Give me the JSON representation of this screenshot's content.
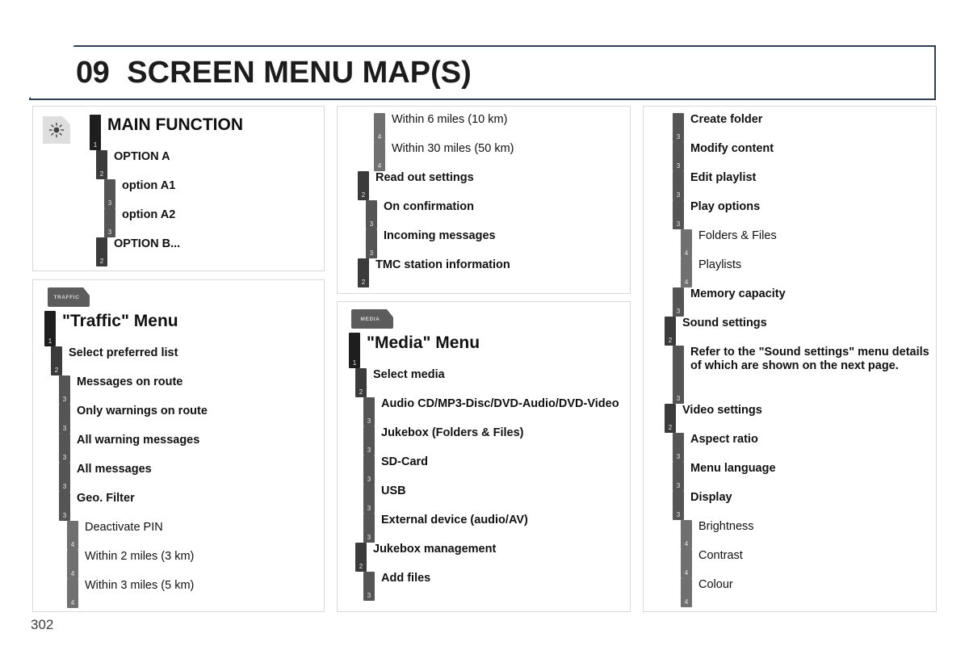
{
  "header": {
    "chapter_number": "09",
    "title": "SCREEN MENU MAP(S)",
    "border_color": "#2e4057"
  },
  "page_number": "302",
  "level_colors": {
    "level1": "#1e1e1e",
    "level2": "#3b3b3b",
    "level3": "#555555",
    "level4": "#707070"
  },
  "panels": [
    {
      "id": "main-function",
      "badge": {
        "type": "sun-icon",
        "label": ""
      },
      "items": [
        {
          "level": 1,
          "label": "MAIN FUNCTION"
        },
        {
          "level": 2,
          "label": "OPTION A"
        },
        {
          "level": 3,
          "label": "option A1"
        },
        {
          "level": 3,
          "label": "option A2"
        },
        {
          "level": 2,
          "label": "OPTION B..."
        }
      ]
    },
    {
      "id": "traffic-menu",
      "badge": {
        "type": "traffic-badge",
        "label": "TRAFFIC"
      },
      "items": [
        {
          "level": 1,
          "label": "\"Traffic\" Menu"
        },
        {
          "level": 2,
          "label": "Select preferred list"
        },
        {
          "level": 3,
          "label": "Messages on route"
        },
        {
          "level": 3,
          "label": "Only warnings on route"
        },
        {
          "level": 3,
          "label": "All warning messages"
        },
        {
          "level": 3,
          "label": "All messages"
        },
        {
          "level": 3,
          "label": "Geo. Filter"
        },
        {
          "level": 4,
          "label": "Deactivate PIN"
        },
        {
          "level": 4,
          "label": "Within 2 miles (3 km)"
        },
        {
          "level": 4,
          "label": "Within 3 miles (5 km)"
        }
      ]
    },
    {
      "id": "traffic-menu-continued",
      "badge": null,
      "items": [
        {
          "level": 4,
          "label": "Within 6 miles (10 km)"
        },
        {
          "level": 4,
          "label": "Within 30 miles (50 km)"
        },
        {
          "level": 2,
          "label": "Read out settings"
        },
        {
          "level": 3,
          "label": "On confirmation"
        },
        {
          "level": 3,
          "label": "Incoming messages"
        },
        {
          "level": 2,
          "label": "TMC station information"
        }
      ]
    },
    {
      "id": "media-menu",
      "badge": {
        "type": "media-badge",
        "label": "MEDIA"
      },
      "items": [
        {
          "level": 1,
          "label": "\"Media\" Menu"
        },
        {
          "level": 2,
          "label": "Select media"
        },
        {
          "level": 3,
          "label": "Audio CD/MP3-Disc/DVD-Audio/DVD-Video"
        },
        {
          "level": 3,
          "label": "Jukebox (Folders & Files)"
        },
        {
          "level": 3,
          "label": "SD-Card"
        },
        {
          "level": 3,
          "label": "USB"
        },
        {
          "level": 3,
          "label": "External device (audio/AV)"
        },
        {
          "level": 2,
          "label": "Jukebox management"
        },
        {
          "level": 3,
          "label": "Add files"
        }
      ]
    },
    {
      "id": "media-menu-continued",
      "badge": null,
      "items": [
        {
          "level": 3,
          "label": "Create folder"
        },
        {
          "level": 3,
          "label": "Modify content"
        },
        {
          "level": 3,
          "label": "Edit playlist"
        },
        {
          "level": 3,
          "label": "Play options"
        },
        {
          "level": 4,
          "label": "Folders & Files"
        },
        {
          "level": 4,
          "label": "Playlists"
        },
        {
          "level": 3,
          "label": "Memory capacity"
        },
        {
          "level": 2,
          "label": "Sound settings"
        },
        {
          "level": 3,
          "tall": true,
          "label": "Refer to the \"Sound settings\" menu details\nof which are shown on the next page."
        },
        {
          "level": 2,
          "label": "Video settings"
        },
        {
          "level": 3,
          "label": "Aspect ratio"
        },
        {
          "level": 3,
          "label": "Menu language"
        },
        {
          "level": 3,
          "label": "Display"
        },
        {
          "level": 4,
          "label": "Brightness"
        },
        {
          "level": 4,
          "label": "Contrast"
        },
        {
          "level": 4,
          "label": "Colour"
        }
      ]
    }
  ]
}
